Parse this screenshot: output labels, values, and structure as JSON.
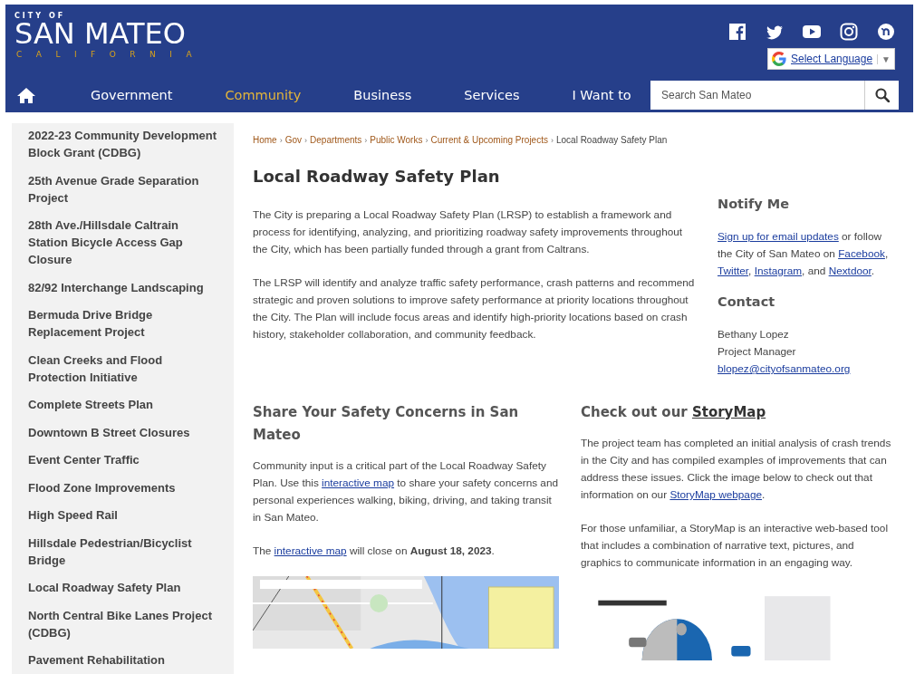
{
  "header": {
    "logo": {
      "top": "CITY OF",
      "name": "SAN MATEO",
      "state": "CALIFORNIA"
    },
    "social": [
      {
        "kind": "facebook"
      },
      {
        "kind": "twitter"
      },
      {
        "kind": "youtube"
      },
      {
        "kind": "instagram"
      },
      {
        "kind": "nextdoor"
      }
    ],
    "translate": {
      "label": "Select Language",
      "arrow": "▼"
    },
    "nav": [
      {
        "kind": "home",
        "selected": false
      },
      {
        "kind": "link",
        "label": "Government",
        "selected": false
      },
      {
        "kind": "link",
        "label": "Community",
        "selected": true
      },
      {
        "kind": "link",
        "label": "Business",
        "selected": false
      },
      {
        "kind": "link",
        "label": "Services",
        "selected": false
      },
      {
        "kind": "link",
        "label": "I Want to",
        "selected": false
      }
    ],
    "search": {
      "placeholder": "Search San Mateo"
    }
  },
  "sidebar": {
    "items": [
      {
        "label": "2022-23 Community Development Block Grant (CDBG)"
      },
      {
        "label": "25th Avenue Grade Separation Project"
      },
      {
        "label": "28th Ave./Hillsdale Caltrain Station Bicycle Access Gap Closure"
      },
      {
        "label": "82/92 Interchange Landscaping"
      },
      {
        "label": "Bermuda Drive Bridge Replacement Project"
      },
      {
        "label": "Clean Creeks and Flood Protection Initiative"
      },
      {
        "label": "Complete Streets Plan"
      },
      {
        "label": "Downtown B Street Closures"
      },
      {
        "label": "Event Center Traffic"
      },
      {
        "label": "Flood Zone Improvements"
      },
      {
        "label": "High Speed Rail"
      },
      {
        "label": "Hillsdale Pedestrian/Bicyclist Bridge"
      },
      {
        "label": "Local Roadway Safety Plan"
      },
      {
        "label": "North Central Bike Lanes Project (CDBG)"
      },
      {
        "label": "Pavement Rehabilitation"
      }
    ]
  },
  "breadcrumb": [
    {
      "kind": "link",
      "label": "Home"
    },
    {
      "kind": "sep",
      "label": "›"
    },
    {
      "kind": "link",
      "label": "Gov"
    },
    {
      "kind": "sep",
      "label": "›"
    },
    {
      "kind": "link",
      "label": "Departments"
    },
    {
      "kind": "sep",
      "label": "›"
    },
    {
      "kind": "link",
      "label": "Public Works"
    },
    {
      "kind": "sep",
      "label": "›"
    },
    {
      "kind": "link",
      "label": "Current & Upcoming Projects"
    },
    {
      "kind": "sep",
      "label": "›"
    },
    {
      "kind": "current",
      "label": "Local Roadway Safety Plan"
    }
  ],
  "title": "Local Roadway Safety Plan",
  "intro": [
    [
      {
        "text": "The City is preparing a Local Roadway Safety Plan (LRSP) to establish a framework and process for identifying, analyzing, and prioritizing roadway safety improvements throughout the City, which has been partially funded through a grant from Caltrans."
      }
    ],
    [
      {
        "text": "The LRSP will identify and analyze traffic safety performance, crash patterns and recommend strategic and proven solutions to improve safety performance at priority locations throughout the City. The Plan will include focus areas and identify high-priority locations based on crash history, stakeholder collaboration, and community feedback."
      }
    ]
  ],
  "aside": [
    {
      "heading": [
        {
          "text": "Notify Me"
        }
      ],
      "paragraphs": [
        [
          {
            "link": "Sign up for email updates"
          },
          {
            "text": " or follow the City of San Mateo on "
          },
          {
            "link": "Facebook"
          },
          {
            "text": ", "
          },
          {
            "link": "Twitter"
          },
          {
            "text": ", "
          },
          {
            "link": "Instagram"
          },
          {
            "text": ", and "
          },
          {
            "link": "Nextdoor"
          },
          {
            "text": "."
          }
        ]
      ]
    },
    {
      "heading": [
        {
          "text": "Contact"
        }
      ],
      "lines": [
        [
          {
            "text": "Bethany Lopez"
          }
        ],
        [
          {
            "text": "Project Manager"
          }
        ],
        [
          {
            "link": "blopez@cityofsanmateo.org"
          }
        ]
      ]
    }
  ],
  "sections": [
    {
      "heading": [
        {
          "text": "Share Your Safety Concerns in San Mateo"
        }
      ],
      "paragraphs": [
        [
          {
            "text": "Community input is a critical part of the Local Roadway Safety Plan. Use this "
          },
          {
            "link": "interactive map"
          },
          {
            "text": " to share your safety concerns and personal experiences walking, biking, driving, and taking transit in San Mateo."
          }
        ],
        [
          {
            "text": "The "
          },
          {
            "link": "interactive map"
          },
          {
            "text": " will close on **August 18, 2023**."
          }
        ]
      ],
      "image": {
        "kind": "map"
      }
    },
    {
      "heading": [
        {
          "text": "Check out our "
        },
        {
          "link": "StoryMap"
        }
      ],
      "paragraphs": [
        [
          {
            "text": "The project team has completed an initial analysis of crash trends in the City and has compiled examples of improvements that can address these issues. Click the image below to check out that information on our "
          },
          {
            "link": "StoryMap webpage"
          },
          {
            "text": "."
          }
        ],
        [
          {
            "text": "For those unfamiliar, a StoryMap is an interactive web-based tool that includes a combination of narrative text, pictures, and graphics to communicate information in an engaging way."
          }
        ]
      ],
      "image": {
        "kind": "chart"
      }
    }
  ]
}
